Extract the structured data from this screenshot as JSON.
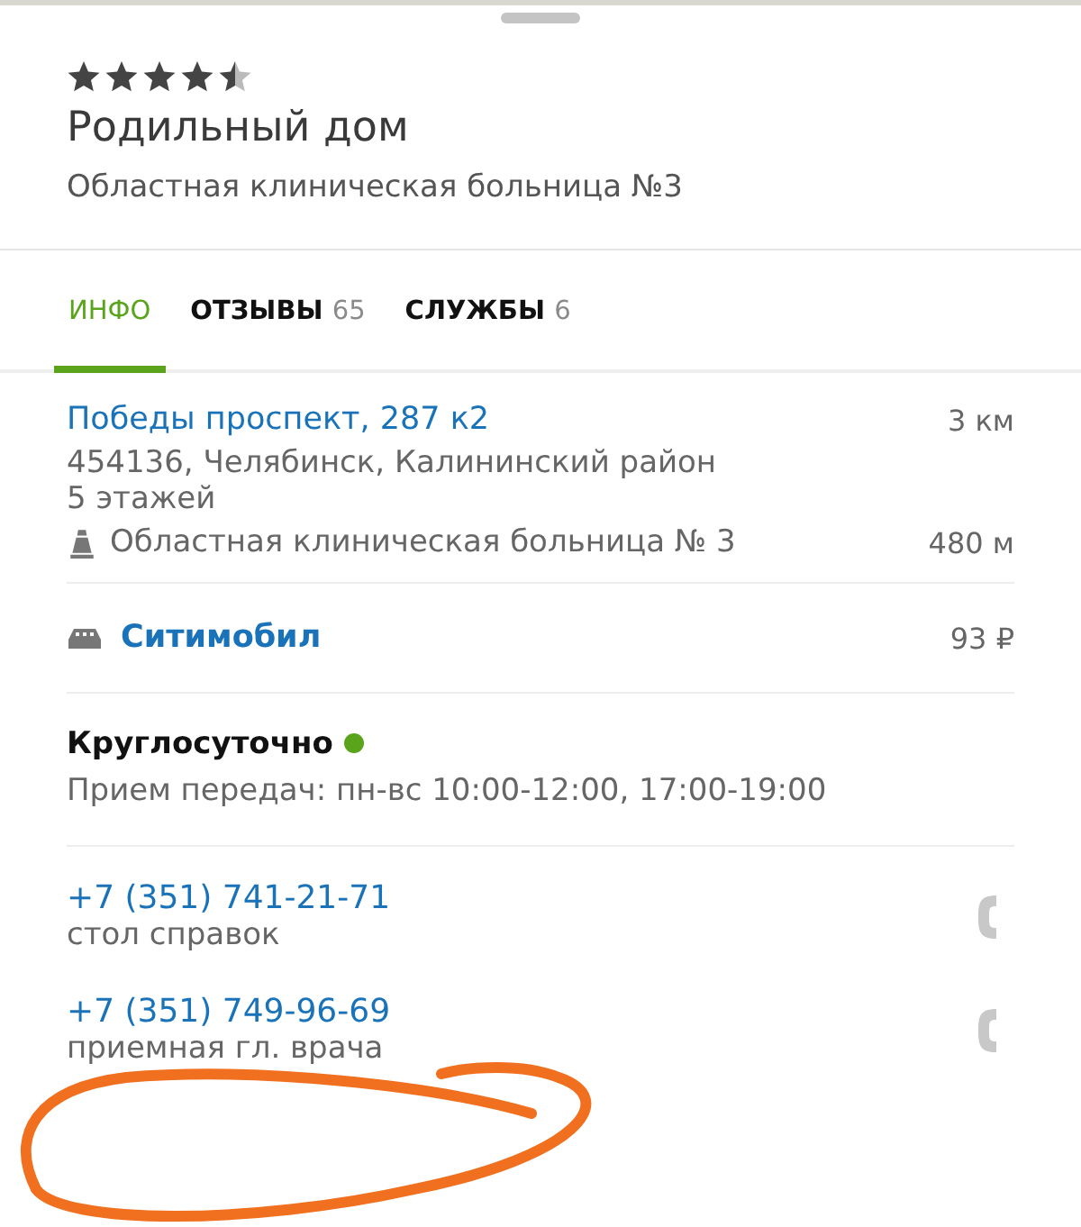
{
  "header": {
    "stars": 4.5,
    "title": "Родильный дом",
    "subtitle": "Областная клиническая больница №3"
  },
  "tabs": [
    {
      "label": "ИНФО",
      "selected": true
    },
    {
      "label": "ОТЗЫВЫ",
      "count": "65",
      "selected": false
    },
    {
      "label": "СЛУЖБЫ",
      "count": "6",
      "selected": false
    }
  ],
  "address": {
    "street": "Победы проспект, 287 к2",
    "distance": "3 км",
    "city": "454136, Челябинск, Калининский район",
    "floors": "5 этажей",
    "stop": "Областная клиническая больница № 3",
    "stop_distance": "480 м"
  },
  "taxi": {
    "name": "Ситимобил",
    "price": "93 ₽"
  },
  "hours": {
    "status": "Круглосуточно",
    "open": true,
    "note": "Прием передач: пн-вс 10:00-12:00, 17:00-19:00"
  },
  "phones": [
    {
      "number": "+7 (351) 741-21-71",
      "label": "стол справок"
    },
    {
      "number": "+7 (351) 749-96-69",
      "label": "приемная гл. врача"
    }
  ]
}
